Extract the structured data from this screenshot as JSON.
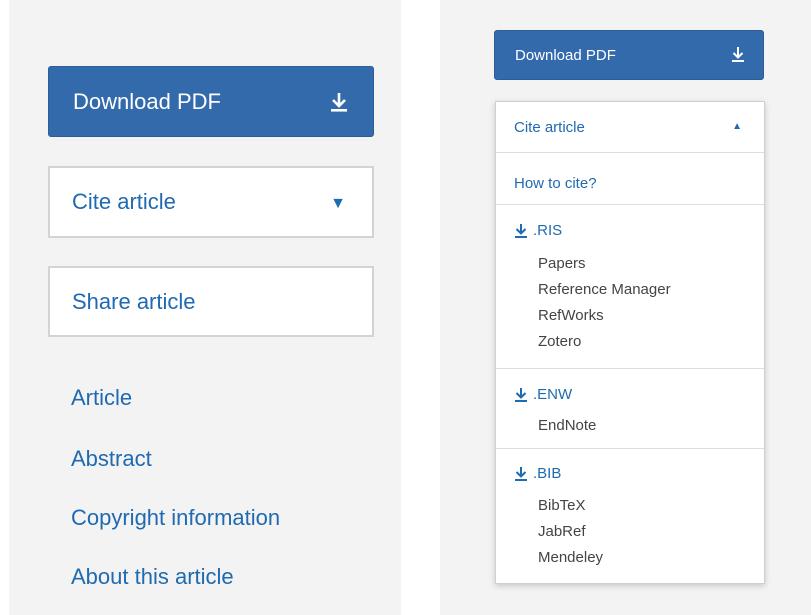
{
  "left": {
    "download_label": "Download PDF",
    "cite_label": "Cite article",
    "share_label": "Share article",
    "nav": [
      "Article",
      "Abstract",
      "Copyright information",
      "About this article"
    ]
  },
  "right": {
    "download_label": "Download PDF",
    "cite_label": "Cite article",
    "how_to_cite": "How to cite?",
    "formats": [
      {
        "ext": ".RIS",
        "apps": [
          "Papers",
          "Reference Manager",
          "RefWorks",
          "Zotero"
        ]
      },
      {
        "ext": ".ENW",
        "apps": [
          "EndNote"
        ]
      },
      {
        "ext": ".BIB",
        "apps": [
          "BibTeX",
          "JabRef",
          "Mendeley"
        ]
      }
    ]
  },
  "colors": {
    "primary": "#336aab",
    "link": "#1f6ab0",
    "panel_bg": "#f3f3f3"
  },
  "icons": {
    "download": "download-icon",
    "caret_down": "caret-down-icon",
    "caret_up": "caret-up-icon"
  }
}
